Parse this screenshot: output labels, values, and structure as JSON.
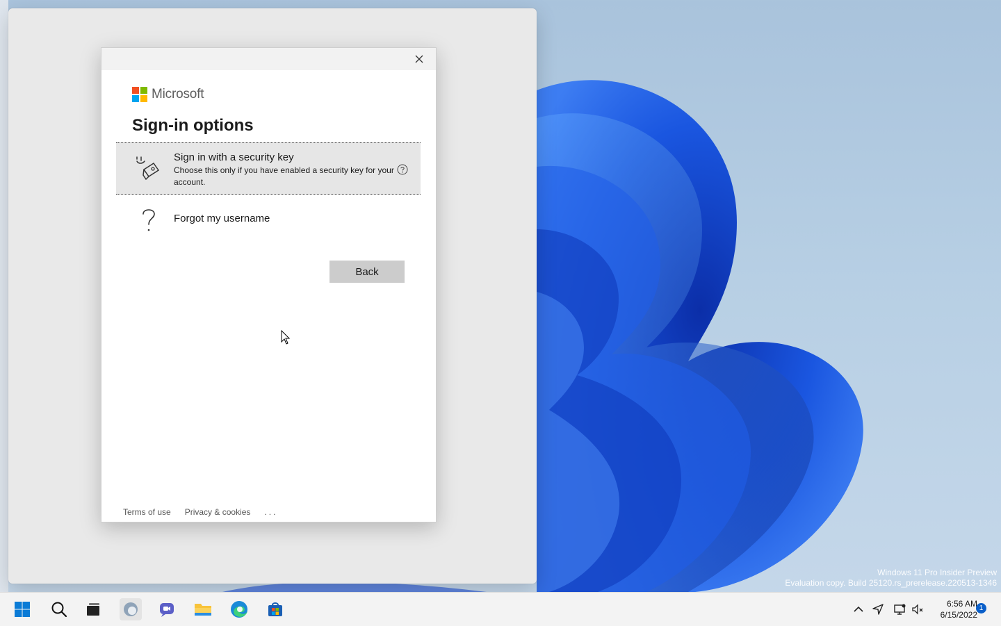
{
  "dialog": {
    "brand": "Microsoft",
    "heading": "Sign-in options",
    "options": [
      {
        "title": "Sign in with a security key",
        "description": "Choose this only if you have enabled a security key for your account.",
        "icon": "security-key-icon"
      },
      {
        "title": "Forgot my username",
        "icon": "question-mark-icon"
      }
    ],
    "back_label": "Back",
    "footer": {
      "terms": "Terms of use",
      "privacy": "Privacy & cookies",
      "more": "..."
    }
  },
  "desktop": {
    "watermark_line1": "Windows 11 Pro Insider Preview",
    "watermark_line2": "Evaluation copy. Build 25120.rs_prerelease.220513-1346"
  },
  "taskbar": {
    "apps": [
      "start-icon",
      "search-icon",
      "task-view-icon",
      "widgets-icon",
      "chat-icon",
      "file-explorer-icon",
      "edge-icon",
      "store-icon"
    ],
    "time": "6:56 AM",
    "date": "6/15/2022",
    "notification_count": "1"
  },
  "colors": {
    "ms_red": "#f25022",
    "ms_green": "#7fba00",
    "ms_blue": "#00a4ef",
    "ms_yellow": "#ffb900",
    "accent": "#0a5fc9"
  }
}
